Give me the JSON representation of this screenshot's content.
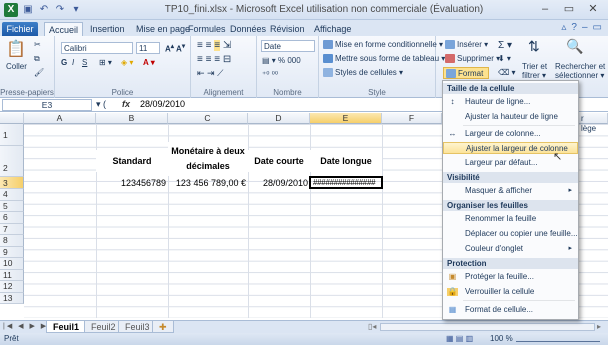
{
  "window": {
    "title": "TP10_fini.xlsx - Microsoft Excel utilisation non commerciale (Évaluation)"
  },
  "tabs": [
    "Fichier",
    "Accueil",
    "Insertion",
    "Mise en page",
    "Formules",
    "Données",
    "Révision",
    "Affichage"
  ],
  "ribbon": {
    "paste": "Coller",
    "font_name": "Calibri",
    "font_size": "11",
    "number_format": "Date",
    "cond_format": "Mise en forme conditionnelle ▾",
    "table_format": "Mettre sous forme de tableau ▾",
    "cell_styles": "Styles de cellules ▾",
    "insert": "Insérer ▾",
    "delete": "Supprimer ▾",
    "format": "Format ▾",
    "sort": "Trier et",
    "find": "Rechercher et",
    "filter": "filtrer ▾",
    "select": "sélectionner ▾",
    "groups": [
      "Presse-papiers",
      "Police",
      "Alignement",
      "Nombre",
      "Style"
    ],
    "behind_menu_1": "r",
    "behind_menu_2": "lège"
  },
  "formula_bar": {
    "name": "E3",
    "fx": "fx",
    "value": "28/09/2010"
  },
  "columns": [
    "A",
    "B",
    "C",
    "D",
    "E",
    "F"
  ],
  "rows": [
    "1",
    "2",
    "3",
    "4",
    "5",
    "6",
    "7",
    "8",
    "9",
    "10",
    "11",
    "12",
    "13"
  ],
  "cells": {
    "b_header": "Standard",
    "c_header_1": "Monétaire à deux",
    "c_header_2": "décimales",
    "d_header": "Date courte",
    "e_header": "Date longue",
    "b3": "123456789",
    "c3": "123 456 789,00 €",
    "d3": "28/09/2010",
    "e3": "###############"
  },
  "sheets": [
    "Feuil1",
    "Feuil2",
    "Feuil3"
  ],
  "status": {
    "ready": "Prêt",
    "zoom": "100 %"
  },
  "menu": {
    "section_size": "Taille de la cellule",
    "row_height": "Hauteur de ligne...",
    "autofit_row": "Ajuster la hauteur de ligne",
    "col_width": "Largeur de colonne...",
    "autofit_col": "Ajuster la largeur de colonne",
    "default_width": "Largeur par défaut...",
    "section_visibility": "Visibilité",
    "hide_show": "Masquer & afficher",
    "section_organize": "Organiser les feuilles",
    "rename": "Renommer la feuille",
    "move_copy": "Déplacer ou copier une feuille...",
    "tab_color": "Couleur d'onglet",
    "section_protection": "Protection",
    "protect_sheet": "Protéger la feuille...",
    "lock_cell": "Verrouiller la cellule",
    "format_cells": "Format de cellule..."
  },
  "colors": {
    "accent": "#1e5aa8",
    "highlight": "#fce39a",
    "grid": "#dadfe8"
  }
}
